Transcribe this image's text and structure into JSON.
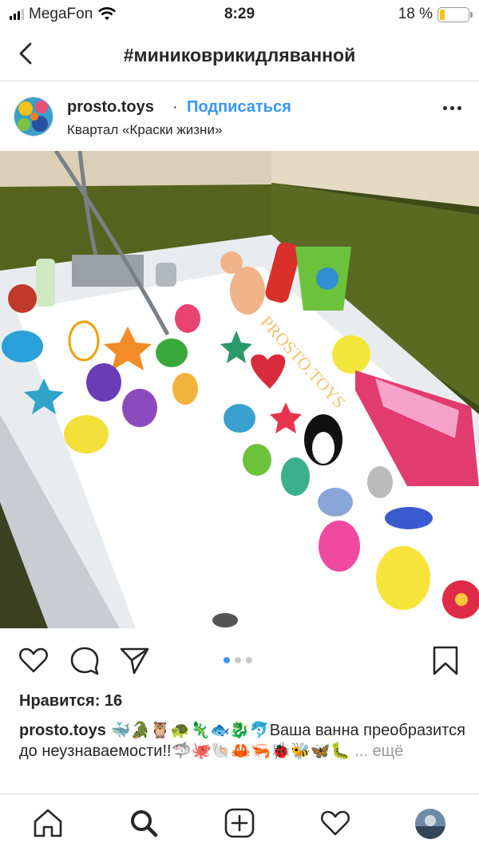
{
  "status_bar": {
    "carrier": "MegaFon",
    "time": "8:29",
    "battery_percent_label": "18 %",
    "battery_level": 0.18,
    "signal_bars_on": 3,
    "signal_bars_total": 4
  },
  "nav": {
    "title": "#миниковрикидляванной",
    "back_icon": "chevron-left-icon"
  },
  "post": {
    "username": "prosto.toys",
    "separator": "·",
    "follow_label": "Подписаться",
    "location": "Квартал «Краски жизни»",
    "watermark": "PROSTO.TOYS",
    "carousel_total": 3,
    "carousel_index": 1,
    "likes_label": "Нравится: 16",
    "caption_username": "prosto.toys",
    "caption_text": "🐳🐊🦉🐢🦎🐟🐉🐬Ваша ванна преобразится до неузнаваемости!!🦈🐙🐚🦀🦐🐞🐝🦋🐛",
    "caption_more": "... ещё"
  },
  "colors": {
    "link_blue": "#3897f0",
    "text": "#262626",
    "divider": "#dbdbdb",
    "muted": "#999999"
  },
  "tabs": [
    "home-icon",
    "search-icon",
    "new-post-icon",
    "activity-heart-icon",
    "profile-avatar"
  ]
}
